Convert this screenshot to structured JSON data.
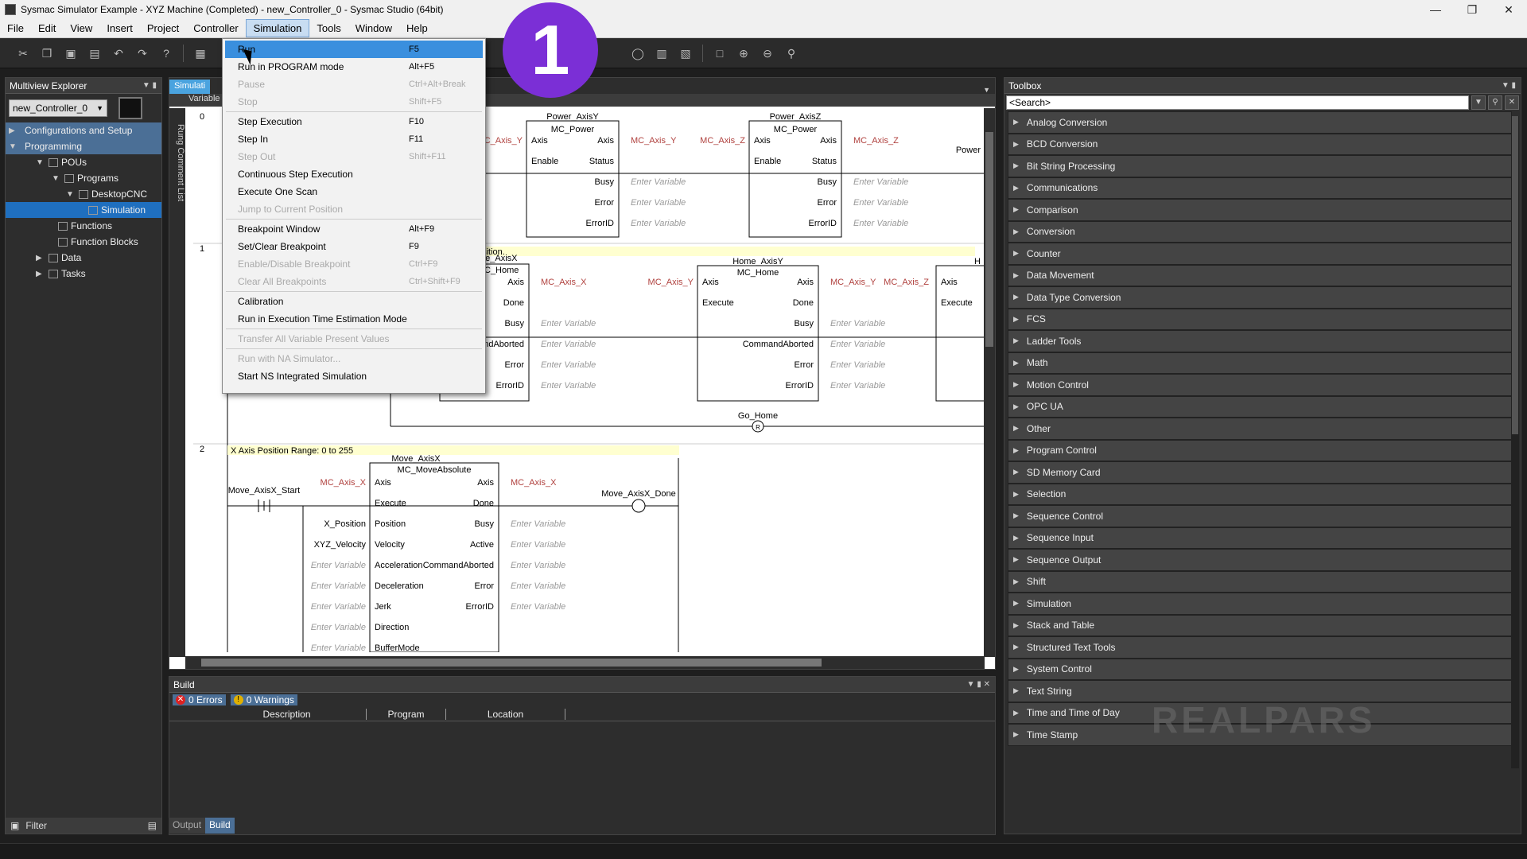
{
  "window": {
    "title": "Sysmac Simulator Example - XYZ Machine (Completed) - new_Controller_0 - Sysmac Studio (64bit)"
  },
  "menu": [
    "File",
    "Edit",
    "View",
    "Insert",
    "Project",
    "Controller",
    "Simulation",
    "Tools",
    "Window",
    "Help"
  ],
  "explorer": {
    "title": "Multiview Explorer",
    "controller": "new_Controller_0",
    "tree": [
      {
        "label": "Configurations and Setup"
      },
      {
        "label": "Programming"
      },
      {
        "label": "POUs"
      },
      {
        "label": "Programs"
      },
      {
        "label": "DesktopCNC"
      },
      {
        "label": "Simulation"
      },
      {
        "label": "Functions"
      },
      {
        "label": "Function Blocks"
      },
      {
        "label": "Data"
      },
      {
        "label": "Tasks"
      }
    ],
    "filter": "Filter"
  },
  "editor": {
    "tab": "Simulati",
    "subtab": "Variable",
    "rung_comment_list": "Rung Comment List",
    "rungs": {
      "r0": "0",
      "r1": "1",
      "r2": "2",
      "power_y": {
        "instance": "Power_AxisY",
        "type": "MC_Power",
        "axis_in": "MC_Axis_Y",
        "axis_out": "MC_Axis_Y"
      },
      "power_z": {
        "instance": "Power_AxisZ",
        "type": "MC_Power",
        "axis_in": "MC_Axis_Z",
        "axis_out": "MC_Axis_Z"
      },
      "power_cut": "Power",
      "home_x": {
        "instance": "me_AxisX",
        "type": "C_Home",
        "axis_out": "MC_Axis_X"
      },
      "home_y": {
        "instance": "Home_AxisY",
        "type": "MC_Home",
        "axis_in": "MC_Axis_Y",
        "axis_out": "MC_Axis_Y"
      },
      "home_z_in": "MC_Axis_Z",
      "home_z_cut": "H",
      "go_home": "Go_Home",
      "comment_r1": "osition.",
      "comment_r2": "X Axis Position Range: 0 to 255",
      "move": {
        "instance": "Move_AxisX",
        "type": "MC_MoveAbsolute",
        "axis_in": "MC_Axis_X",
        "axis_out": "MC_Axis_X"
      },
      "start_contact": "Move_AxisX_Start",
      "done_coil": "Move_AxisX_Done",
      "x_position": "X_Position",
      "xyz_velocity": "XYZ_Velocity",
      "enter_var": "Enter Variable",
      "pins": {
        "axis": "Axis",
        "enable": "Enable",
        "status": "Status",
        "busy": "Busy",
        "error": "Error",
        "errorid": "ErrorID",
        "execute": "Execute",
        "done": "Done",
        "cmd_aborted": "CommandAborted",
        "cmd_aborted_cut": "CommandAborted",
        "position": "Position",
        "velocity": "Velocity",
        "acceleration": "Acceleration",
        "deceleration": "Deceleration",
        "jerk": "Jerk",
        "direction": "Direction",
        "buffermode": "BufferMode",
        "active": "Active"
      },
      "reset_coil_symbol": "R"
    }
  },
  "simulation_menu": {
    "items": [
      {
        "label": "Run",
        "shortcut": "F5"
      },
      {
        "label": "Run in PROGRAM mode",
        "shortcut": "Alt+F5"
      },
      {
        "label": "Pause",
        "shortcut": "Ctrl+Alt+Break"
      },
      {
        "label": "Stop",
        "shortcut": "Shift+F5"
      },
      {
        "label": "Step Execution",
        "shortcut": "F10"
      },
      {
        "label": "Step In",
        "shortcut": "F11"
      },
      {
        "label": "Step Out",
        "shortcut": "Shift+F11"
      },
      {
        "label": "Continuous Step Execution",
        "shortcut": ""
      },
      {
        "label": "Execute One Scan",
        "shortcut": ""
      },
      {
        "label": "Jump to Current Position",
        "shortcut": ""
      },
      {
        "label": "Breakpoint Window",
        "shortcut": "Alt+F9"
      },
      {
        "label": "Set/Clear Breakpoint",
        "shortcut": "F9"
      },
      {
        "label": "Enable/Disable Breakpoint",
        "shortcut": "Ctrl+F9"
      },
      {
        "label": "Clear All Breakpoints",
        "shortcut": "Ctrl+Shift+F9"
      },
      {
        "label": "Calibration",
        "shortcut": ""
      },
      {
        "label": "Run in Execution Time Estimation Mode",
        "shortcut": ""
      },
      {
        "label": "Transfer All Variable Present Values",
        "shortcut": ""
      },
      {
        "label": "Run with NA Simulator...",
        "shortcut": ""
      },
      {
        "label": "Start NS Integrated Simulation",
        "shortcut": ""
      }
    ]
  },
  "build": {
    "title": "Build",
    "errors": "0 Errors",
    "warnings": "0 Warnings",
    "columns": [
      "Description",
      "Program",
      "Location"
    ],
    "tabs": [
      "Output",
      "Build"
    ]
  },
  "toolbox": {
    "title": "Toolbox",
    "search_placeholder": "<Search>",
    "categories": [
      "Analog Conversion",
      "BCD Conversion",
      "Bit String Processing",
      "Communications",
      "Comparison",
      "Conversion",
      "Counter",
      "Data Movement",
      "Data Type Conversion",
      "FCS",
      "Ladder Tools",
      "Math",
      "Motion Control",
      "OPC UA",
      "Other",
      "Program Control",
      "SD Memory Card",
      "Selection",
      "Sequence Control",
      "Sequence Input",
      "Sequence Output",
      "Shift",
      "Simulation",
      "Stack and Table",
      "Structured Text Tools",
      "System Control",
      "Text String",
      "Time and Time of Day",
      "Time Stamp"
    ]
  },
  "overlay": {
    "step_number": "1",
    "watermark": "REALPARS"
  },
  "colors": {
    "accent_purple": "#7b2fd6",
    "highlight_blue": "#3a8fde",
    "variable_red": "#b0413e"
  }
}
